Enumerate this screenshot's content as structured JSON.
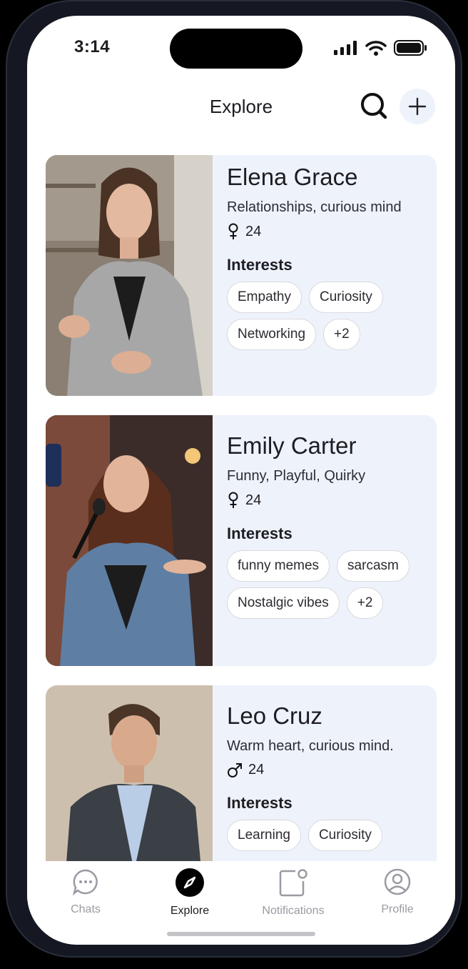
{
  "status": {
    "time": "3:14"
  },
  "header": {
    "title": "Explore"
  },
  "interests_label": "Interests",
  "profiles": [
    {
      "name": "Elena Grace",
      "tagline": "Relationships, curious mind",
      "gender": "female",
      "age": "24",
      "interests": [
        "Empathy",
        "Curiosity",
        "Networking",
        "+2"
      ]
    },
    {
      "name": "Emily Carter",
      "tagline": "Funny, Playful, Quirky",
      "gender": "female",
      "age": "24",
      "interests": [
        "funny memes",
        "sarcasm",
        "Nostalgic vibes",
        "+2"
      ]
    },
    {
      "name": "Leo Cruz",
      "tagline": "Warm heart, curious mind.",
      "gender": "male",
      "age": "24",
      "interests": [
        "Learning",
        "Curiosity"
      ]
    }
  ],
  "tabs": [
    {
      "label": "Chats",
      "icon": "chat-bubble-icon"
    },
    {
      "label": "Explore",
      "icon": "compass-icon"
    },
    {
      "label": "Notifications",
      "icon": "notification-icon"
    },
    {
      "label": "Profile",
      "icon": "profile-icon"
    }
  ],
  "colors": {
    "card_bg": "#eef2fb",
    "active": "#000000",
    "inactive": "#9a9aa3"
  }
}
